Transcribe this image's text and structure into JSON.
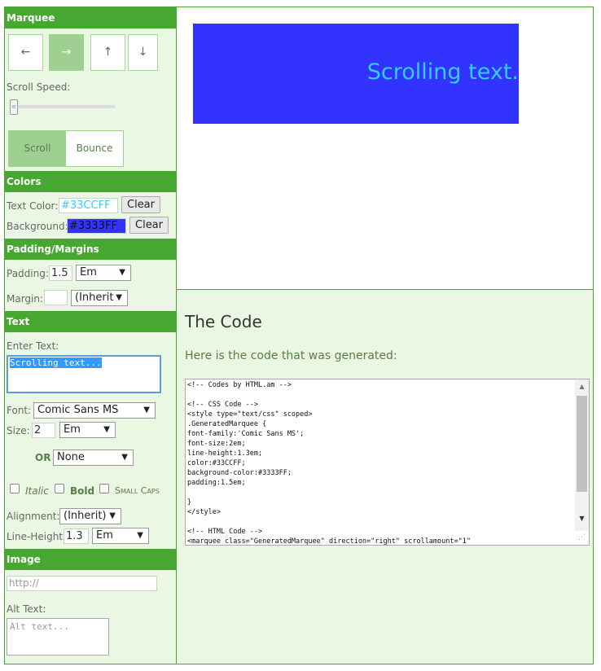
{
  "marquee_section": {
    "title": "Marquee",
    "direction_buttons": [
      {
        "label": "←",
        "active": false
      },
      {
        "label": "→",
        "active": true
      },
      {
        "label": "↑",
        "active": false
      },
      {
        "label": "↓",
        "active": false
      }
    ],
    "scroll_speed_label": "Scroll Speed:",
    "scroll_speed_value": 1,
    "scroll_label": "Scroll",
    "bounce_label": "Bounce"
  },
  "colors_section": {
    "title": "Colors",
    "text_color_label": "Text Color:",
    "text_color_value": "#33CCFF",
    "background_label": "Background:",
    "background_value": "#3333FF",
    "clear_label": "Clear"
  },
  "padding_section": {
    "title": "Padding/Margins",
    "padding_label": "Padding:",
    "padding_value": "1.5",
    "padding_unit": "Em",
    "margin_label": "Margin:",
    "margin_value": "",
    "margin_unit": "(Inherit"
  },
  "text_section": {
    "title": "Text",
    "enter_text_label": "Enter Text:",
    "enter_text_value": "Scrolling text...",
    "font_label": "Font:",
    "font_value": "Comic Sans MS",
    "size_label": "Size:",
    "size_value": "2",
    "size_unit": "Em",
    "or_label": "OR",
    "or_value": "None",
    "italic_label": "Italic",
    "bold_label": "Bold",
    "small_caps_label": "Small Caps",
    "alignment_label": "Alignment:",
    "alignment_value": "(Inherit)",
    "line_height_label": "Line-Height:",
    "line_height_value": "1.3",
    "line_height_unit": "Em"
  },
  "image_section": {
    "title": "Image",
    "url_placeholder": "http://",
    "alt_text_label": "Alt Text:",
    "alt_text_placeholder": "Alt text..."
  },
  "preview": {
    "marquee_text": "Scrolling text.",
    "text_color": "#33CCFF",
    "background_color": "#3333FF"
  },
  "code_panel": {
    "heading": "The Code",
    "subheading": "Here is the code that was generated:",
    "code": "<!-- Codes by HTML.am -->\n\n<!-- CSS Code -->\n<style type=\"text/css\" scoped>\n.GeneratedMarquee {\nfont-family:'Comic Sans MS';\nfont-size:2em;\nline-height:1.3em;\ncolor:#33CCFF;\nbackground-color:#3333FF;\npadding:1.5em;\n\n}\n</style>\n\n<!-- HTML Code -->\n<marquee class=\"GeneratedMarquee\" direction=\"right\" scrollamount=\"1\""
  },
  "colors": {
    "accent": "#47A831",
    "panel_bg": "#EAF7E3",
    "button_active": "#9ED091"
  }
}
